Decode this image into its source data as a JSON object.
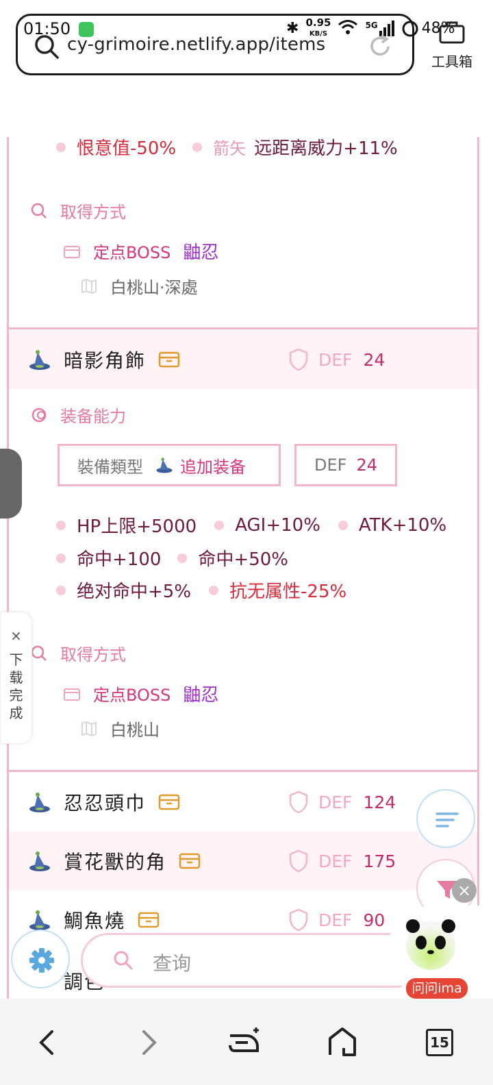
{
  "status": {
    "time": "01:50",
    "speed": "0.95",
    "speed_unit": "KB/S",
    "net": "5G",
    "battery": "48%"
  },
  "browser": {
    "url": "cy-grimoire.netlify.app/items",
    "toolbox_label": "工具箱"
  },
  "item1": {
    "stats": [
      {
        "text": "恨意值-50%",
        "tone": "red"
      },
      {
        "label": "箭矢",
        "text": "远距离威力+11%",
        "tone": "dark"
      }
    ],
    "obtain_title": "取得方式",
    "boss_label": "定点BOSS",
    "boss_name": "鼬忍",
    "place": "白桃山·深處"
  },
  "item2": {
    "name": "暗影角飾",
    "def_label": "DEF",
    "def_value": "24",
    "ability_title": "装备能力",
    "type_label": "裝備類型",
    "type_value": "追加装备",
    "tag_def_label": "DEF",
    "tag_def_value": "24",
    "stats_row1": [
      "HP上限+5000",
      "AGI+10%",
      "ATK+10%"
    ],
    "stats_row2": [
      "命中+100",
      "命中+50%"
    ],
    "stats_row3": [
      "绝对命中+5%",
      "抗无属性-25%"
    ],
    "obtain_title": "取得方式",
    "boss_label": "定点BOSS",
    "boss_name": "鼬忍",
    "place": "白桃山"
  },
  "items": [
    {
      "name": "忍忍頭巾",
      "def_label": "DEF",
      "def_value": "124"
    },
    {
      "name": "賞花獸的角",
      "def_label": "DEF",
      "def_value": "175"
    },
    {
      "name": "鯛魚燒",
      "def_label": "DEF",
      "def_value": "90"
    },
    {
      "name": "調色"
    }
  ],
  "download_panel": {
    "close": "×",
    "text": "下载完成"
  },
  "search": {
    "placeholder": "查询"
  },
  "assistant": {
    "label": "问问ima"
  },
  "nav": {
    "tabs_count": "15"
  },
  "colors": {
    "accent_pink": "#e77aa0",
    "border_pink": "#f3b6c8",
    "def_value": "#c02d6a",
    "boss_name": "#a12fcf",
    "stat_red": "#d62a3a"
  }
}
